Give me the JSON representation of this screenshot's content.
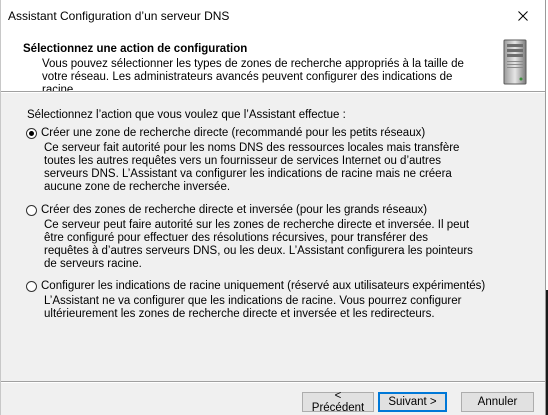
{
  "window": {
    "title": "Assistant Configuration d’un serveur DNS"
  },
  "header": {
    "title": "Sélectionnez une action de configuration",
    "subtitle": "Vous pouvez sélectionner les types de zones de recherche appropriés à la taille de votre réseau. Les administrateurs avancés peuvent configurer des indications de racine."
  },
  "prompt": "Sélectionnez l’action que vous voulez que l’Assistant effectue :",
  "options": [
    {
      "label": "Créer une zone de recherche directe (recommandé pour les petits réseaux)",
      "description": "Ce serveur fait autorité pour les noms DNS des ressources locales mais transfère toutes les autres requêtes vers un fournisseur de services Internet ou d’autres serveurs DNS. L’Assistant va configurer les indications de racine mais ne créera aucune zone de recherche inversée.",
      "checked": true
    },
    {
      "label": "Créer des zones de recherche directe et inversée (pour les grands réseaux)",
      "description": "Ce serveur peut faire autorité sur les zones de recherche directe et inversée. Il peut être configuré pour effectuer des résolutions récursives, pour transférer des requêtes à d’autres serveurs DNS, ou les deux. L’Assistant configurera les pointeurs de serveurs racine.",
      "checked": false
    },
    {
      "label": "Configurer les indications de racine uniquement (réservé aux utilisateurs expérimentés)",
      "description": "L’Assistant ne va configurer que les indications de racine. Vous pourrez configurer ultérieurement les zones de recherche directe et inversée et les redirecteurs.",
      "checked": false
    }
  ],
  "buttons": {
    "back": "< Précédent",
    "next": "Suivant >",
    "cancel": "Annuler"
  },
  "icons": {
    "close": "close-icon",
    "server": "server-icon"
  }
}
